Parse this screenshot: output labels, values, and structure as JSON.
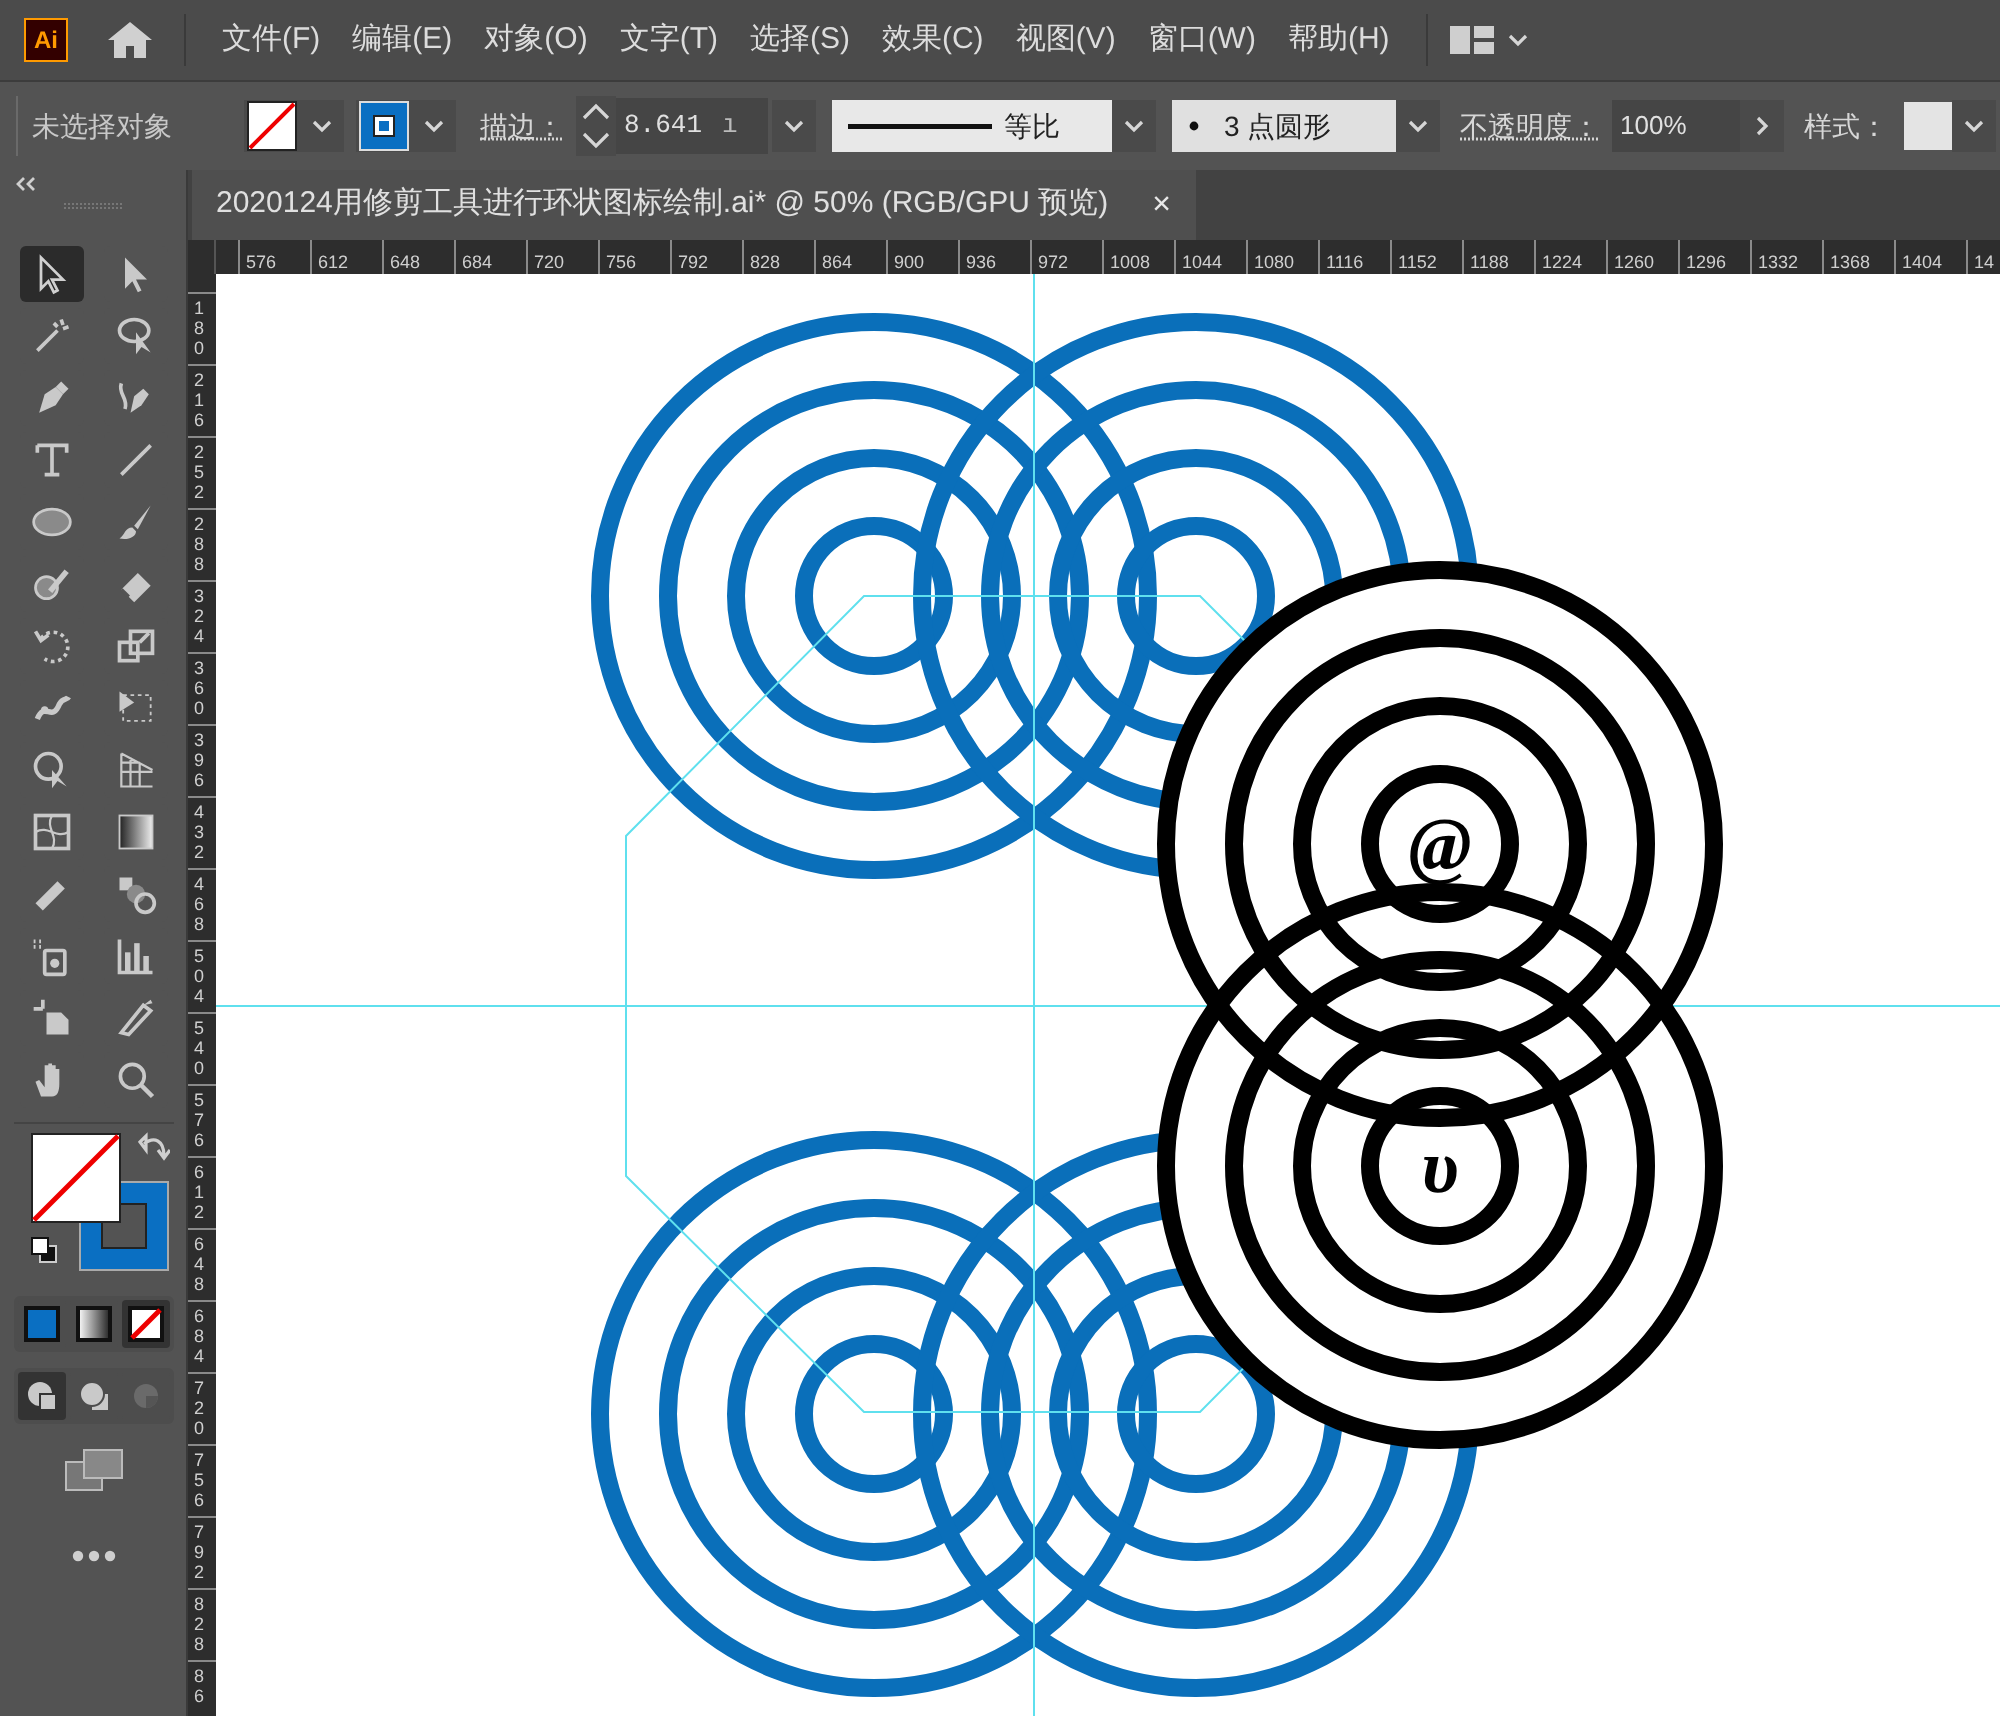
{
  "app": {
    "logo": "Ai"
  },
  "menu": [
    "文件(F)",
    "编辑(E)",
    "对象(O)",
    "文字(T)",
    "选择(S)",
    "效果(C)",
    "视图(V)",
    "窗口(W)",
    "帮助(H)"
  ],
  "control_bar": {
    "selection": "未选择对象",
    "stroke_label": "描边：",
    "stroke_weight": "8.641",
    "stroke_weight_unit": "ı",
    "stroke_profile": "等比",
    "brush": "3 点圆形",
    "opacity_label": "不透明度：",
    "opacity": "100%",
    "style_label": "样式："
  },
  "document_tab": {
    "title": "2020124用修剪工具进行环状图标绘制.ai* @ 50% (RGB/GPU 预览)",
    "close": "×"
  },
  "ruler_h": [
    "576",
    "612",
    "648",
    "684",
    "720",
    "756",
    "792",
    "828",
    "864",
    "900",
    "936",
    "972",
    "1008",
    "1044",
    "1080",
    "1116",
    "1152",
    "1188",
    "1224",
    "1260",
    "1296",
    "1332",
    "1368",
    "1404",
    "14"
  ],
  "ruler_v": [
    "180",
    "216",
    "252",
    "288",
    "324",
    "360",
    "396",
    "432",
    "468",
    "504",
    "540",
    "576",
    "612",
    "648",
    "684",
    "720",
    "756",
    "792",
    "828",
    "86"
  ],
  "tools": [
    {
      "kind": "selection",
      "selected": true
    },
    {
      "kind": "direct",
      "selected": false
    },
    {
      "kind": "wand",
      "selected": false
    },
    {
      "kind": "lasso",
      "selected": false
    },
    {
      "kind": "pen",
      "selected": false
    },
    {
      "kind": "curvature",
      "selected": false
    },
    {
      "kind": "type",
      "selected": false
    },
    {
      "kind": "line",
      "selected": false
    },
    {
      "kind": "ellipse",
      "selected": false
    },
    {
      "kind": "brush",
      "selected": false
    },
    {
      "kind": "shaper",
      "selected": false
    },
    {
      "kind": "eraser",
      "selected": false
    },
    {
      "kind": "rotate",
      "selected": false
    },
    {
      "kind": "scale",
      "selected": false
    },
    {
      "kind": "puppet",
      "selected": false
    },
    {
      "kind": "transform",
      "selected": false
    },
    {
      "kind": "builder",
      "selected": false
    },
    {
      "kind": "perspective",
      "selected": false
    },
    {
      "kind": "mesh",
      "selected": false
    },
    {
      "kind": "gradient",
      "selected": false
    },
    {
      "kind": "ruler",
      "selected": false
    },
    {
      "kind": "blend",
      "selected": false
    },
    {
      "kind": "sprayer",
      "selected": false
    },
    {
      "kind": "graph",
      "selected": false
    },
    {
      "kind": "artboard",
      "selected": false
    },
    {
      "kind": "knife",
      "selected": false
    },
    {
      "kind": "hand",
      "selected": false
    },
    {
      "kind": "zoom",
      "selected": false
    }
  ],
  "color_modes": [
    {
      "kind": "color",
      "selected": false
    },
    {
      "kind": "gradient",
      "selected": false
    },
    {
      "kind": "none",
      "selected": true
    }
  ],
  "draw_modes": [
    {
      "kind": "normal",
      "selected": true
    },
    {
      "kind": "behind",
      "selected": false
    },
    {
      "kind": "inside",
      "selected": false
    }
  ],
  "artwork": {
    "glyphs": [
      "@",
      "υ"
    ]
  }
}
